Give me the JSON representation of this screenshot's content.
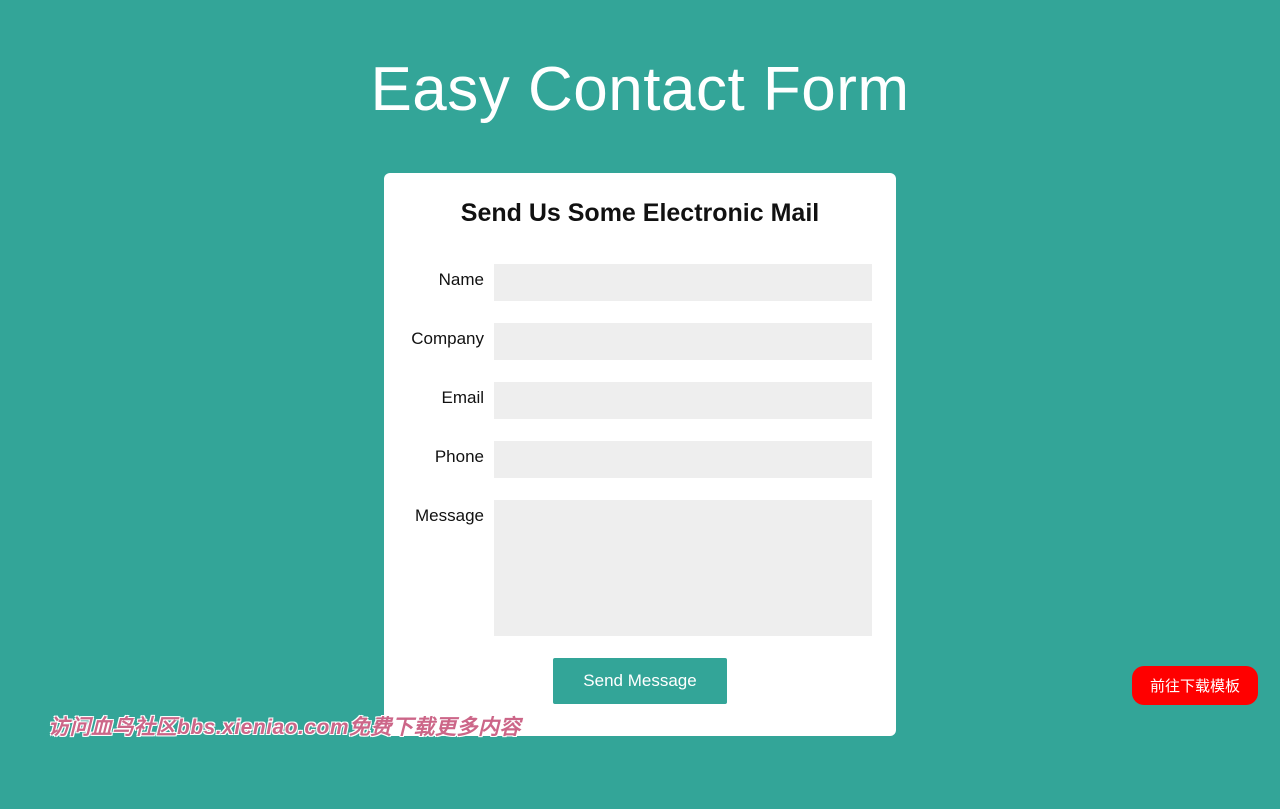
{
  "page": {
    "title": "Easy Contact Form"
  },
  "card": {
    "title": "Send Us Some Electronic Mail"
  },
  "form": {
    "fields": {
      "name": {
        "label": "Name",
        "value": ""
      },
      "company": {
        "label": "Company",
        "value": ""
      },
      "email": {
        "label": "Email",
        "value": ""
      },
      "phone": {
        "label": "Phone",
        "value": ""
      },
      "message": {
        "label": "Message",
        "value": ""
      }
    },
    "submit_label": "Send Message"
  },
  "floating_button": {
    "label": "前往下载模板"
  },
  "watermark": {
    "text": "访问血鸟社区bbs.xieniao.com免费下载更多内容"
  }
}
